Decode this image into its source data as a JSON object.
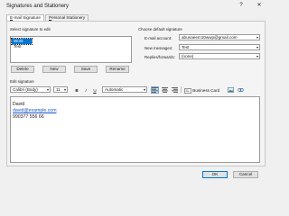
{
  "window": {
    "title": "Signatures and Stationery",
    "help": "?",
    "close": "✕"
  },
  "tabs": [
    {
      "label": "E-mail Signature",
      "underline": "E",
      "rest": "-mail Signature"
    },
    {
      "label": "Personal Stationery",
      "underline": "P",
      "rest": "ersonal Stationery"
    }
  ],
  "select_signature": {
    "label": "Select signature to edit",
    "items": [
      "Work",
      "Test"
    ],
    "selected": "Work"
  },
  "buttons": {
    "delete": "Delete",
    "new": "New",
    "save": "Save",
    "rename": "Rename"
  },
  "default_signature": {
    "label": "Choose default signature",
    "email_account_label": "E-mail account:",
    "email_account_value": "abunaeem10wwp@gmail.com",
    "new_messages_label": "New messages:",
    "new_messages_value": "Test",
    "replies_label": "Replies/forwards:",
    "replies_value": "(none)"
  },
  "edit_signature": {
    "label": "Edit signature",
    "font": "Calibri (Body)",
    "size": "11",
    "bold": "B",
    "italic": "I",
    "underline": "U",
    "color": "Automatic",
    "business_card": "Business Card",
    "content": {
      "name": "David",
      "email": "david@example.com",
      "phone": "990377 556 66"
    }
  },
  "footer": {
    "ok": "OK",
    "cancel": "Cancel"
  }
}
